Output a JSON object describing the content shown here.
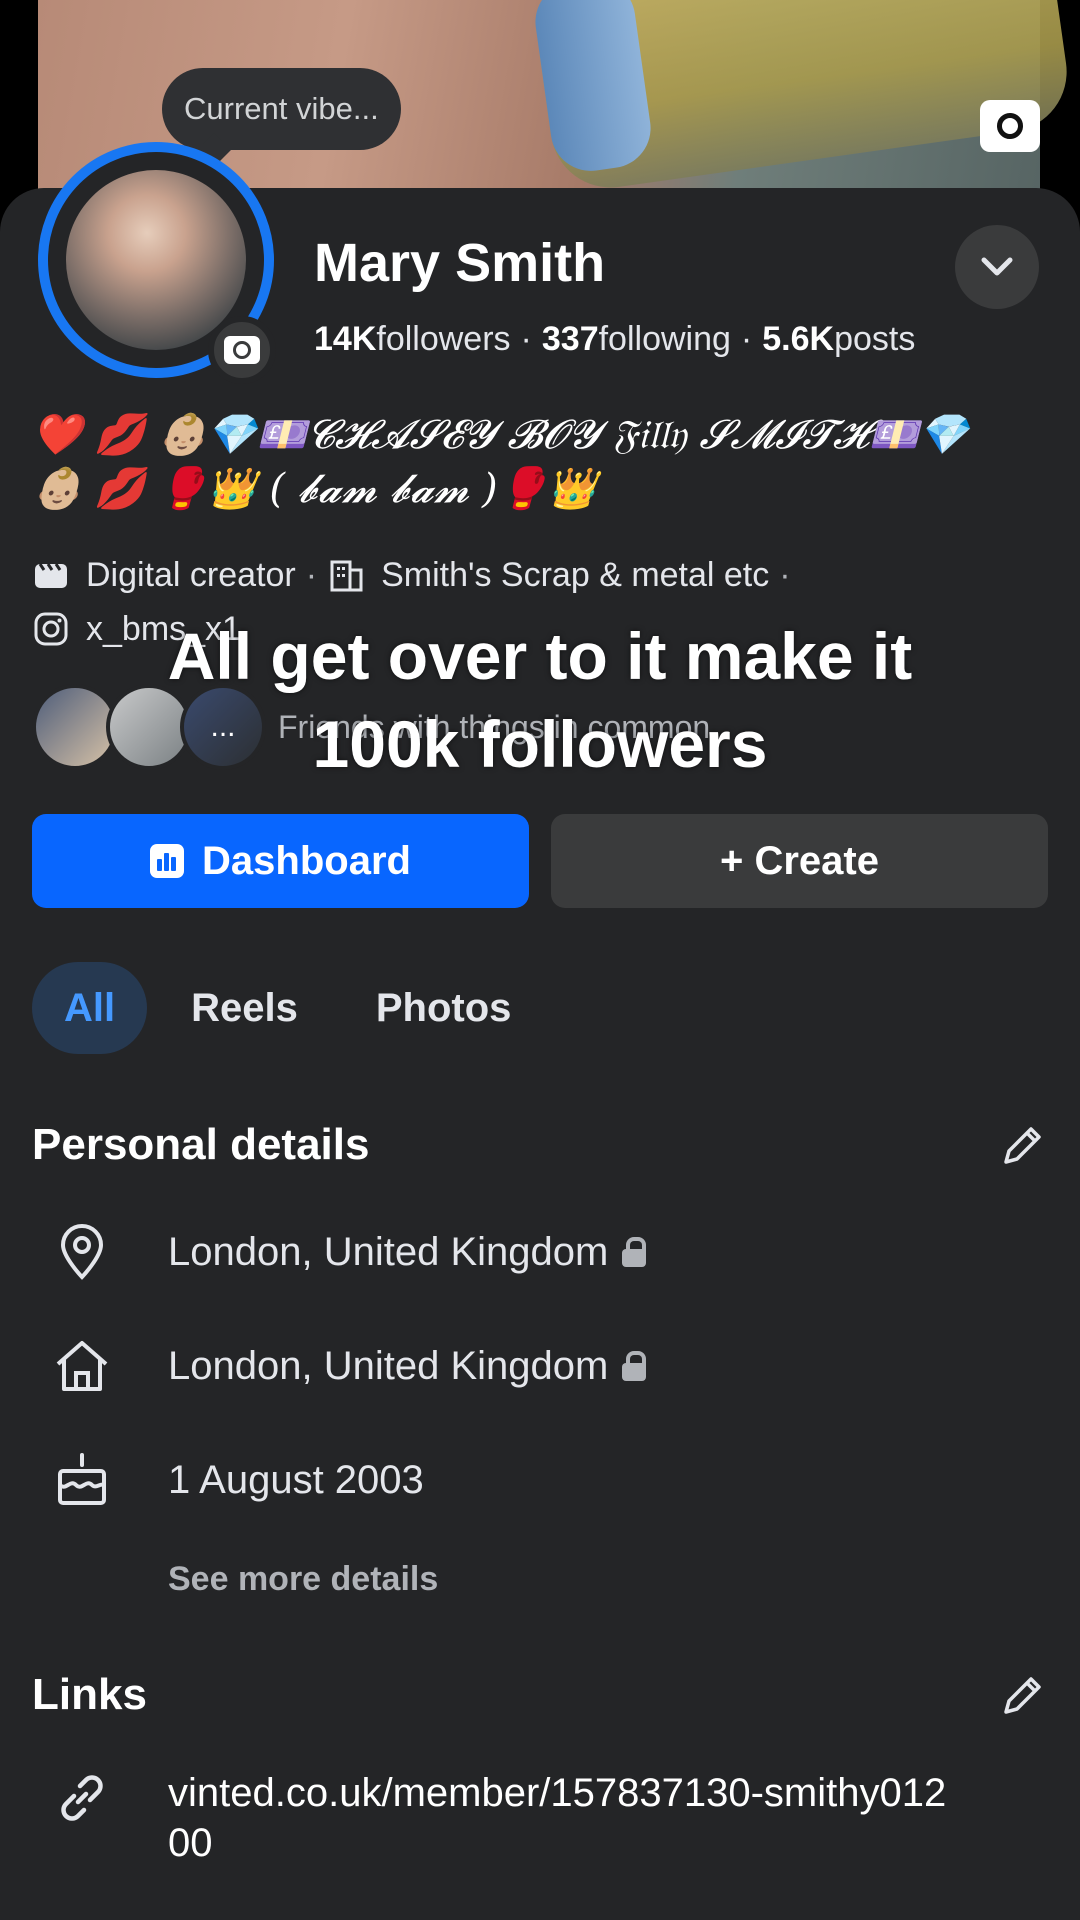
{
  "cover": {
    "vibe_label": "Current vibe..."
  },
  "profile": {
    "name": "Mary Smith",
    "followers_count": "14K",
    "followers_label": "followers",
    "following_count": "337",
    "following_label": "following",
    "posts_count": "5.6K",
    "posts_label": "posts",
    "bio_line1": "❤️ 💋 👶🏼💎💷𝓒𝓗𝓐𝓢𝓔𝓨 𝓑𝓞𝓨 𝔉𝔦𝔩𝔩𝔶 𝓢𝓜𝓘𝓣𝓗💷💎",
    "bio_line2": "👶🏼 💋 🥊👑 ( 𝓫𝓪𝓶 𝓫𝓪𝓶 )🥊👑",
    "category": "Digital creator",
    "business": "Smith's Scrap & metal etc",
    "instagram": "x_bms_x1",
    "friends_label": "Friends with things in common",
    "friends_more": "..."
  },
  "overlay": {
    "line1": "All get over to it make it",
    "line2": "100k followers"
  },
  "actions": {
    "dashboard_label": "Dashboard",
    "create_label": "+ Create"
  },
  "tabs": [
    {
      "label": "All"
    },
    {
      "label": "Reels"
    },
    {
      "label": "Photos"
    }
  ],
  "personal_details": {
    "title": "Personal details",
    "items": [
      {
        "icon": "location-pin-icon",
        "text": "London, United Kingdom"
      },
      {
        "icon": "home-icon",
        "text": "London, United Kingdom"
      },
      {
        "icon": "birthday-cake-icon",
        "text": "1 August 2003"
      }
    ],
    "see_more": "See more details"
  },
  "links": {
    "title": "Links",
    "items": [
      {
        "icon": "link-icon",
        "text": "vinted.co.uk/member/157837130-smithy01200"
      }
    ]
  },
  "colors": {
    "accent": "#0866ff",
    "background": "#242527",
    "secondary_button": "#3a3b3c",
    "tab_active_bg": "#263951",
    "tab_active_text": "#4599ff"
  }
}
